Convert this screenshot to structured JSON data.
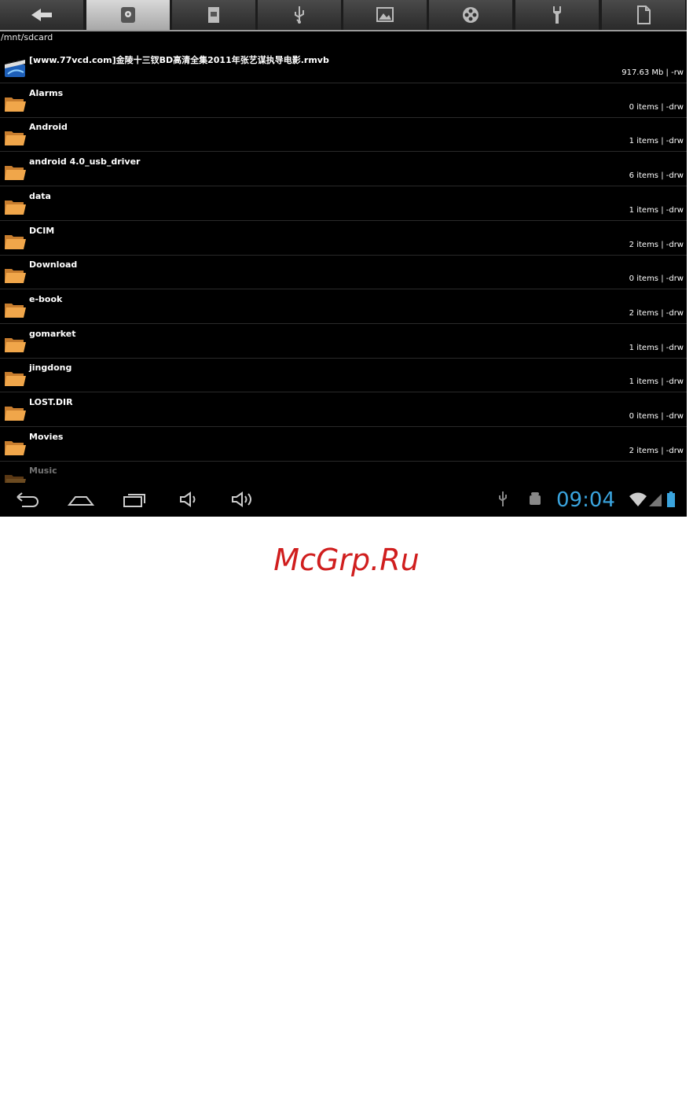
{
  "toolbar": {
    "buttons": [
      {
        "icon": "back-arrow-icon",
        "active": false
      },
      {
        "icon": "internal-storage-icon",
        "active": true
      },
      {
        "icon": "sd-card-icon",
        "active": false
      },
      {
        "icon": "usb-icon",
        "active": false
      },
      {
        "icon": "image-icon",
        "active": false
      },
      {
        "icon": "film-reel-icon",
        "active": false
      },
      {
        "icon": "wrench-icon",
        "active": false
      },
      {
        "icon": "document-icon",
        "active": false
      }
    ]
  },
  "path": "/mnt/sdcard",
  "files": [
    {
      "name": "[www.77vcd.com]金陵十三钗BD高清全集2011年张艺谋执导电影.rmvb",
      "meta": "917.63 Mb  | -rw",
      "type": "video"
    },
    {
      "name": "Alarms",
      "meta": "0 items | -drw",
      "type": "folder"
    },
    {
      "name": "Android",
      "meta": "1 items | -drw",
      "type": "folder"
    },
    {
      "name": "android 4.0_usb_driver",
      "meta": "6 items | -drw",
      "type": "folder"
    },
    {
      "name": "data",
      "meta": "1 items | -drw",
      "type": "folder"
    },
    {
      "name": "DCIM",
      "meta": "2 items | -drw",
      "type": "folder"
    },
    {
      "name": "Download",
      "meta": "0 items | -drw",
      "type": "folder"
    },
    {
      "name": "e-book",
      "meta": "2 items | -drw",
      "type": "folder"
    },
    {
      "name": "gomarket",
      "meta": "1 items | -drw",
      "type": "folder"
    },
    {
      "name": "jingdong",
      "meta": "1 items | -drw",
      "type": "folder"
    },
    {
      "name": "LOST.DIR",
      "meta": "0 items | -drw",
      "type": "folder"
    },
    {
      "name": "Movies",
      "meta": "2 items | -drw",
      "type": "folder"
    },
    {
      "name": "Music",
      "meta": "",
      "type": "folder"
    }
  ],
  "status": {
    "time": "09:04"
  },
  "watermark": "McGrp.Ru",
  "colors": {
    "clock": "#3aa4de",
    "folder": "#f0a64a",
    "watermark": "#d01e1e"
  }
}
